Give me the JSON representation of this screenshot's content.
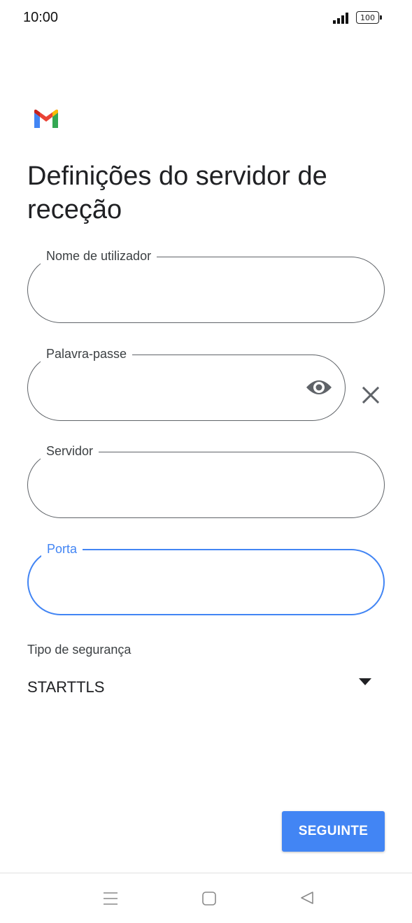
{
  "status_bar": {
    "time": "10:00",
    "battery": "100",
    "signal_icon": "cellular-signal-icon"
  },
  "app": {
    "logo_icon": "gmail-logo-icon"
  },
  "page": {
    "title": "Definições do servidor de receção"
  },
  "form": {
    "username": {
      "label": "Nome de utilizador",
      "value": ""
    },
    "password": {
      "label": "Palavra-passe",
      "value": "",
      "visibility_icon": "eye-icon",
      "clear_icon": "close-icon"
    },
    "server": {
      "label": "Servidor",
      "value": ""
    },
    "port": {
      "label": "Porta",
      "value": "",
      "focused": true
    },
    "security": {
      "label": "Tipo de segurança",
      "value": "STARTTLS",
      "icon": "dropdown-arrow-icon"
    }
  },
  "actions": {
    "next_label": "SEGUINTE"
  },
  "nav_bar": {
    "icons": [
      "menu-icon",
      "home-icon",
      "back-icon"
    ]
  },
  "colors": {
    "accent": "#4285f4",
    "outline": "#5f6368",
    "text": "#202124"
  }
}
